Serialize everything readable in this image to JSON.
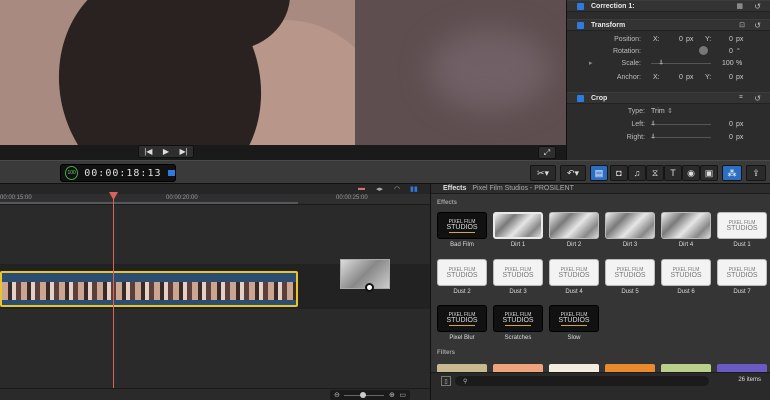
{
  "viewer": {
    "play_icon": "▶",
    "prev_icon": "|◀",
    "next_icon": "▶|",
    "expand_icon": "⤢"
  },
  "inspector": {
    "correction": {
      "title": "Correction 1:"
    },
    "transform": {
      "title": "Transform",
      "position": {
        "label": "Position:",
        "x_label": "X:",
        "x_value": "0",
        "x_unit": "px",
        "y_label": "Y:",
        "y_value": "0",
        "y_unit": "px"
      },
      "rotation": {
        "label": "Rotation:",
        "value": "0",
        "unit": "°"
      },
      "scale": {
        "label": "Scale:",
        "value": "100",
        "unit": "%"
      },
      "anchor": {
        "label": "Anchor:",
        "x_label": "X:",
        "x_value": "0",
        "x_unit": "px",
        "y_label": "Y:",
        "y_value": "0",
        "y_unit": "px"
      }
    },
    "crop": {
      "title": "Crop",
      "type": {
        "label": "Type:",
        "value": "Trim"
      },
      "left": {
        "label": "Left:",
        "value": "0",
        "unit": "px"
      },
      "right": {
        "label": "Right:",
        "value": "0",
        "unit": "px"
      }
    }
  },
  "toolbar": {
    "timecode": "00:00:18:13",
    "timecode_badge": "100",
    "icons": [
      "blade-tool-icon",
      "undo-icon",
      "clip-view-icon",
      "photos-icon",
      "music-icon",
      "transitions-icon",
      "titles-icon",
      "generators-icon",
      "themes-icon",
      "effects-icon",
      "share-icon"
    ]
  },
  "timeline": {
    "ruler_labels": [
      "00:00:15:00",
      "00:00:20:00",
      "00:00:25:00"
    ]
  },
  "browser": {
    "title": "Effects",
    "subtitle": "Pixel Film Studios - PROSILENT",
    "section_effects": "Effects",
    "section_filters": "Filters",
    "pfs_text_line1": "PIXEL FILM",
    "pfs_text_line2": "STUDIOS",
    "effects": [
      {
        "label": "Bad Film",
        "style": "dark"
      },
      {
        "label": "Dirt 1",
        "style": "dirt"
      },
      {
        "label": "Dirt 2",
        "style": "dirt"
      },
      {
        "label": "Dirt 3",
        "style": "dirt"
      },
      {
        "label": "Dirt 4",
        "style": "dirt"
      },
      {
        "label": "Dust 1",
        "style": "pfs"
      },
      {
        "label": "Dust 2",
        "style": "pfs"
      },
      {
        "label": "Dust 3",
        "style": "pfs"
      },
      {
        "label": "Dust 4",
        "style": "pfs"
      },
      {
        "label": "Dust 5",
        "style": "pfs"
      },
      {
        "label": "Dust 6",
        "style": "pfs"
      },
      {
        "label": "Dust 7",
        "style": "pfs"
      },
      {
        "label": "Pixel Blur",
        "style": "dark"
      },
      {
        "label": "Scratches",
        "style": "dark"
      },
      {
        "label": "Slow",
        "style": "dark"
      }
    ],
    "filter_colors": [
      "#c9b98f",
      "#f0a47c",
      "#f3ece0",
      "#e98b2c",
      "#b8d08a",
      "#6a5bc4"
    ],
    "count": "26 items",
    "search_icon": "search-icon"
  }
}
